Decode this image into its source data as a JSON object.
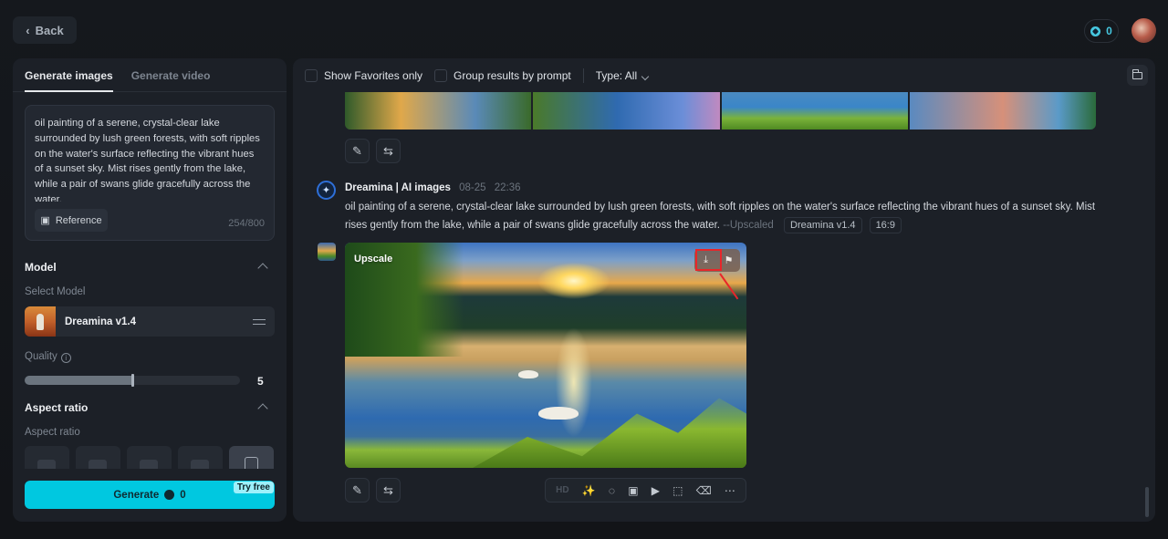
{
  "topbar": {
    "back_label": "Back",
    "credits": "0",
    "credits_icon": "credit-coin-icon",
    "avatar_icon": "user-avatar"
  },
  "left_panel": {
    "tabs": [
      {
        "label": "Generate images",
        "active": true
      },
      {
        "label": "Generate video",
        "active": false
      }
    ],
    "prompt": {
      "value": "oil painting of a serene, crystal-clear lake surrounded by lush green forests, with soft ripples on the water's surface reflecting the vibrant hues of a sunset sky. Mist rises gently from the lake, while a pair of swans glide gracefully across the water.",
      "char_count": "254/800",
      "reference_label": "Reference"
    },
    "model_section": {
      "title": "Model",
      "select_label": "Select Model",
      "selected_model": "Dreamina v1.4"
    },
    "quality": {
      "label": "Quality",
      "value": "5",
      "fraction": 0.5
    },
    "aspect_section": {
      "title": "Aspect ratio",
      "label": "Aspect ratio",
      "options_count": 5,
      "selected_index": 4
    },
    "generate": {
      "label": "Generate",
      "cost": "0",
      "badge": "Try free",
      "color": "#00c8e0"
    }
  },
  "main": {
    "filters": {
      "favorites_label": "Show Favorites only",
      "group_label": "Group results by prompt",
      "type_label": "Type: All"
    },
    "message": {
      "sender": "Dreamina | AI images",
      "date": "08-25",
      "time": "22:36",
      "prompt": "oil painting of a serene, crystal-clear lake surrounded by lush green forests, with soft ripples on the water's surface reflecting the vibrant hues of a sunset sky. Mist rises gently from the lake, while a pair of swans glide gracefully across the water.",
      "suffix": "--Upscaled",
      "tags": [
        "Dreamina v1.4",
        "16:9"
      ]
    },
    "image": {
      "overlay_label": "Upscale",
      "actions": [
        "download-icon",
        "bookmark-icon"
      ]
    },
    "toolbar": {
      "hd_label": "HD",
      "tools": [
        "magic-wand-icon",
        "inpaint-icon",
        "expand-frame-icon",
        "add-to-video-icon",
        "resize-icon",
        "eraser-icon",
        "more-icon"
      ]
    },
    "accent_highlight": "#e8262a"
  }
}
